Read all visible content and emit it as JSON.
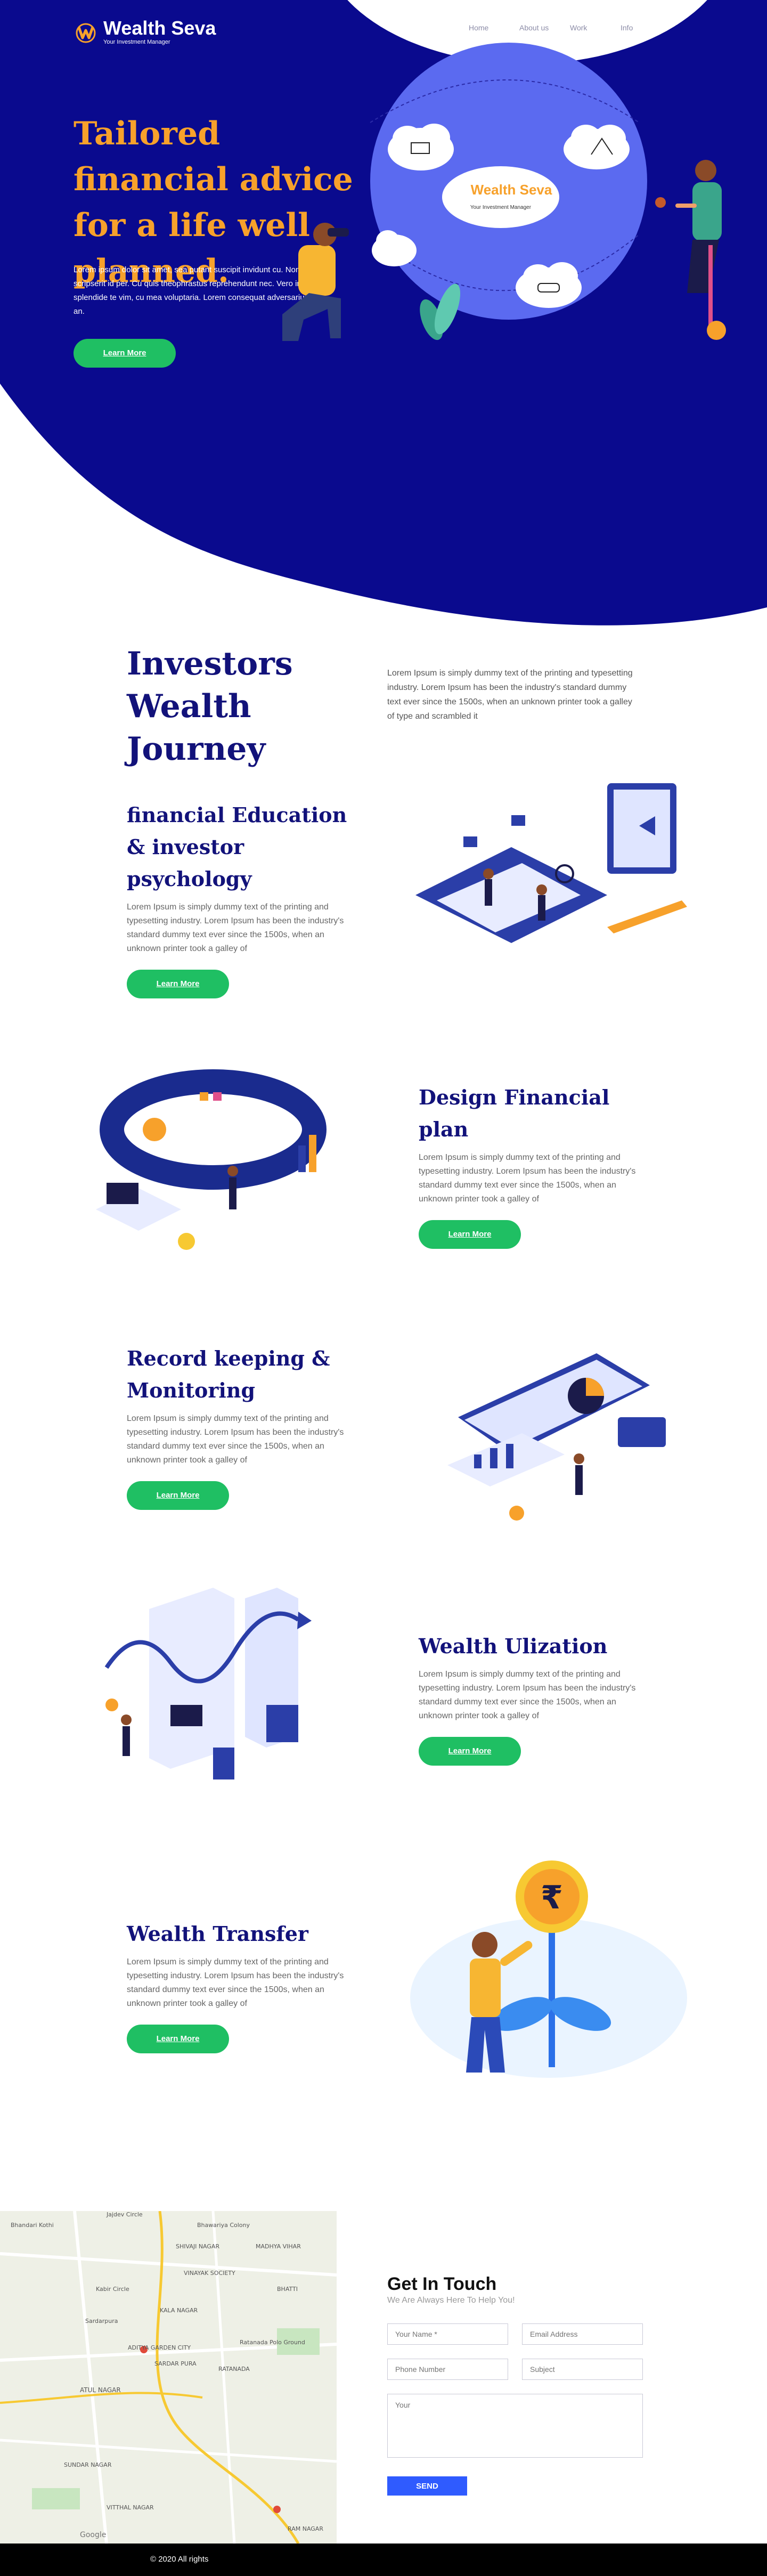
{
  "brand": {
    "name": "Wealth Seva",
    "tagline": "Your Investment Manager",
    "colors": {
      "navy": "#0a0a8e",
      "orange": "#f7a12b",
      "green": "#1fbf63",
      "blue": "#2f5bff"
    }
  },
  "nav": {
    "items": [
      "Home",
      "About us",
      "Work",
      "Info"
    ]
  },
  "hero": {
    "title": "Tailored financial advice for a life well planned.",
    "text": "Lorem ipsum dolor sit amet, sea putant suscipit invidunt cu. Nonumy scripserit id per. Cu quis theophrastus reprehendunt nec. Vero invidunt splendide te vim, cu mea voluptaria. Lorem consequat adversarium vel an.",
    "button": "Learn More",
    "globe_logo_name": "Wealth Seva",
    "globe_logo_tag": "Your Investment Manager"
  },
  "journey": {
    "title": "Investors Wealth Journey",
    "text": "Lorem Ipsum is simply dummy text of the printing and typesetting industry. Lorem Ipsum has been the industry's standard dummy text ever since the 1500s, when an unknown printer took a galley of type and scrambled it"
  },
  "features": [
    {
      "title": "financial Education & investor psychology",
      "text": "Lorem Ipsum is simply dummy text of the printing and typesetting industry. Lorem Ipsum has been the industry's standard dummy text ever since the 1500s, when an unknown printer took a galley of",
      "button": "Learn More"
    },
    {
      "title": "Design Financial plan",
      "text": "Lorem Ipsum is simply dummy text of the printing and typesetting industry. Lorem Ipsum has been the industry's standard dummy text ever since the 1500s, when an unknown printer took a galley of",
      "button": "Learn More"
    },
    {
      "title": "Record keeping & Monitoring",
      "text": "Lorem Ipsum is simply dummy text of the printing and typesetting industry. Lorem Ipsum has been the industry's standard dummy text ever since the 1500s, when an unknown printer took a galley of",
      "button": "Learn More"
    },
    {
      "title": "Wealth Ulization",
      "text": "Lorem Ipsum is simply dummy text of the printing and typesetting industry. Lorem Ipsum has been the industry's standard dummy text ever since the 1500s, when an unknown printer took a galley of",
      "button": "Learn More"
    },
    {
      "title": "Wealth Transfer",
      "text": "Lorem Ipsum is simply dummy text of the printing and typesetting industry. Lorem Ipsum has been the industry's standard dummy text ever since the 1500s, when an unknown printer took a galley of",
      "button": "Learn More"
    }
  ],
  "map": {
    "labels": [
      "Jajdev Circle",
      "Bhandari Kothi",
      "Bhawariya Colony",
      "SHIVAJI NAGAR",
      "VINAYAK SOCIETY",
      "Kabir Circle",
      "KALA NAGAR",
      "Sardarpura",
      "RATANADA",
      "Ratanada Polo Ground",
      "ADITYA GARDEN CITY",
      "SARDAR PURA",
      "ATUL NAGAR",
      "SUNDAR NAGAR",
      "VITTHAL NAGAR",
      "RAM NAGAR",
      "MADHYA VIHAR",
      "BHATTI",
      "Google"
    ]
  },
  "contact": {
    "title": "Get In Touch",
    "subtitle": "We Are Always Here To Help You!",
    "name_placeholder": "Your Name *",
    "email_placeholder": "Email Address",
    "phone_placeholder": "Phone Number",
    "subject_placeholder": "Subject",
    "message_placeholder": "Your",
    "send": "SEND"
  },
  "footer": {
    "text": "© 2020 All rights"
  }
}
